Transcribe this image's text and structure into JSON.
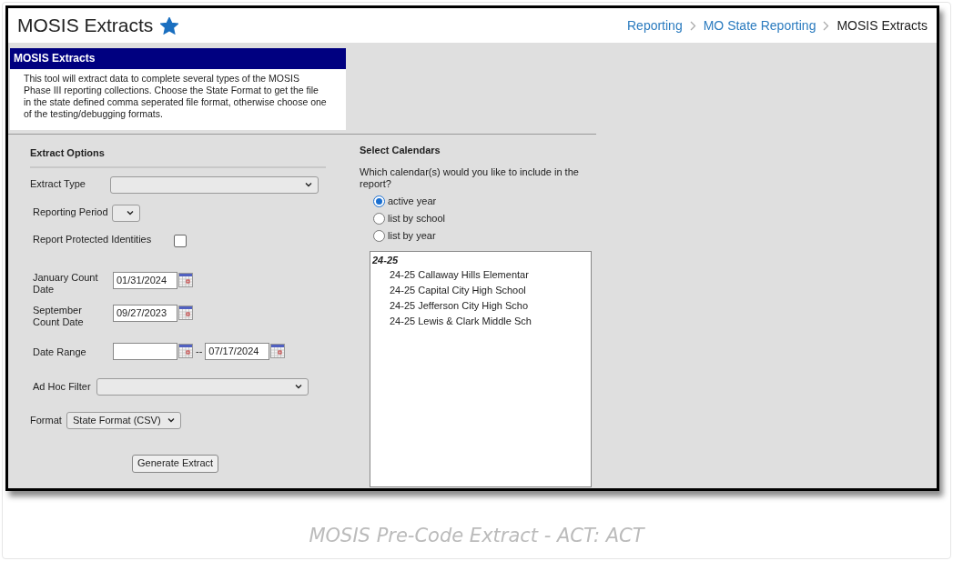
{
  "page": {
    "title": "MOSIS Extracts",
    "favorite": true
  },
  "breadcrumbs": [
    {
      "label": "Reporting",
      "link": true
    },
    {
      "label": "MO State Reporting",
      "link": true
    },
    {
      "label": "MOSIS Extracts",
      "link": false
    }
  ],
  "info": {
    "title": "MOSIS Extracts",
    "text": "This tool will extract data to complete several types of the MOSIS Phase III reporting collections. Choose the State Format to get the file in the state defined comma seperated file format, otherwise choose one of the testing/debugging formats."
  },
  "extract_options": {
    "title": "Extract Options",
    "extract_type": {
      "label": "Extract Type"
    },
    "reporting_period": {
      "label": "Reporting Period"
    },
    "protected_identities": {
      "label": "Report Protected Identities",
      "checked": false
    },
    "january_count_date": {
      "label": "January Count Date",
      "value": "01/31/2024"
    },
    "september_count_date": {
      "label": "September Count Date",
      "value": "09/27/2023"
    },
    "date_range": {
      "label": "Date Range",
      "separator": "--",
      "end": "07/17/2024"
    },
    "ad_hoc_filter": {
      "label": "Ad Hoc Filter"
    },
    "format": {
      "label": "Format",
      "value": "State Format (CSV)"
    },
    "button": "Generate Extract"
  },
  "select_calendars": {
    "title": "Select Calendars",
    "question": "Which calendar(s) would you like to include in the report?",
    "options": [
      {
        "label": "active year",
        "selected": true
      },
      {
        "label": "list by school",
        "selected": false
      },
      {
        "label": "list by year",
        "selected": false
      }
    ],
    "groups": [
      {
        "label": "24-25",
        "items": [
          "24-25 Callaway Hills Elementar",
          "24-25 Capital City High School",
          "24-25 Jefferson City High Scho",
          "24-25 Lewis & Clark Middle Sch"
        ]
      }
    ]
  },
  "caption": "MOSIS Pre-Code Extract - ACT: ACT"
}
